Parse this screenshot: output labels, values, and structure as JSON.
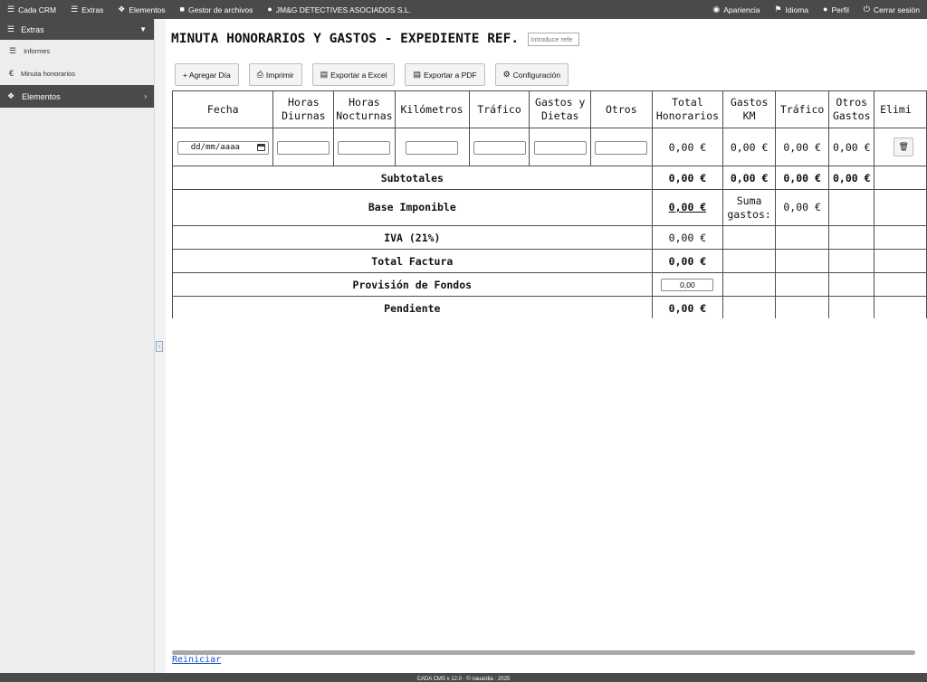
{
  "topnav": {
    "items": [
      {
        "icon": "database-icon",
        "label": "Cada CRM"
      },
      {
        "icon": "database-icon",
        "label": "Extras"
      },
      {
        "icon": "cubes-icon",
        "label": "Elementos"
      },
      {
        "icon": "folder-icon",
        "label": "Gestor de archivos"
      },
      {
        "icon": "user-icon",
        "label": "JM&G DETECTIVES ASOCIADOS S.L."
      }
    ],
    "right_items": [
      {
        "icon": "eye-icon",
        "label": "Apariencia"
      },
      {
        "icon": "flag-icon",
        "label": "Idioma"
      },
      {
        "icon": "user-icon",
        "label": "Perfil"
      },
      {
        "icon": "power-icon",
        "label": "Cerrar sesión"
      }
    ]
  },
  "sidebar": {
    "extras_label": "Extras",
    "items": [
      {
        "icon": "list-icon",
        "label": "Informes"
      },
      {
        "icon": "euro-icon",
        "label": "Minuta honorarios"
      }
    ],
    "elementos_label": "Elementos"
  },
  "main": {
    "title": "MINUTA HONORARIOS Y GASTOS - EXPEDIENTE REF.",
    "ref_placeholder": "Introduce refe",
    "toolbar": {
      "add_day": "+ Agregar Día",
      "print": "Imprimir",
      "export_excel": "Exportar a Excel",
      "export_pdf": "Exportar a PDF",
      "config": "Configuración"
    }
  },
  "table": {
    "headers": {
      "fecha": "Fecha",
      "horas_diurnas": "Horas Diurnas",
      "horas_nocturnas": "Horas Nocturnas",
      "kilometros": "Kilómetros",
      "trafico": "Tráfico",
      "gastos_dietas": "Gastos y Dietas",
      "otros": "Otros",
      "total_honorarios": "Total Honorarios",
      "gastos_km": "Gastos KM",
      "trafico2": "Tráfico",
      "otros_gastos": "Otros Gastos",
      "eliminar": "Elimi"
    },
    "row": {
      "date_placeholder": "dd/mm/aaaa",
      "total_honorarios": "0,00 €",
      "gastos_km": "0,00 €",
      "trafico": "0,00 €",
      "otros_gastos": "0,00 €"
    },
    "subtotales": {
      "label": "Subtotales",
      "total_honorarios": "0,00 €",
      "gastos_km": "0,00 €",
      "trafico": "0,00 €",
      "otros_gastos": "0,00 €"
    },
    "base_imponible": {
      "label": "Base Imponible",
      "value": "0,00 €",
      "suma_gastos_label": "Suma gastos:",
      "suma_gastos_value": "0,00 €"
    },
    "iva": {
      "label": "IVA (21%)",
      "value": "0,00 €"
    },
    "total_factura": {
      "label": "Total Factura",
      "value": "0,00 €"
    },
    "provision": {
      "label": "Provisión de Fondos",
      "value": "0,00"
    },
    "pendiente": {
      "label": "Pendiente",
      "value": "0,00 €"
    }
  },
  "reset_label": "Reiniciar",
  "footer_text": "CADA CMS v 12.0 · © nauardia · 2025"
}
